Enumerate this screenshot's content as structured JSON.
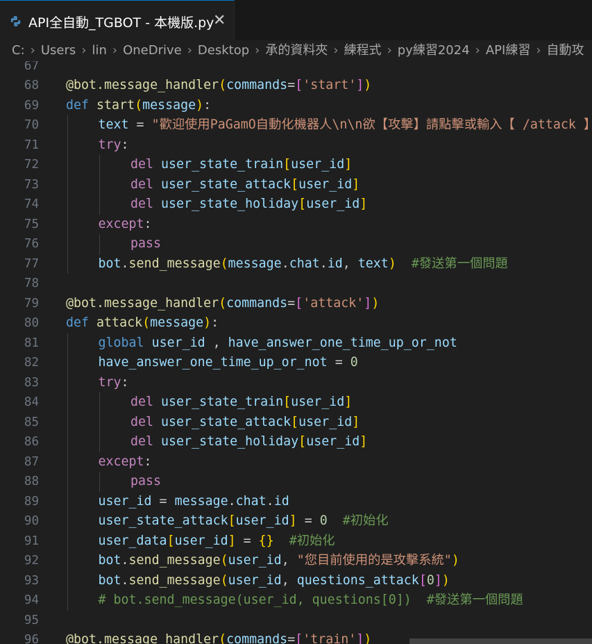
{
  "tab": {
    "title": "API全自動_TGBOT - 本機版.py",
    "close_glyph": "✕",
    "icon": "python-file-icon"
  },
  "breadcrumb": [
    "C:",
    "Users",
    "lin",
    "OneDrive",
    "Desktop",
    "承的資料夾",
    "練程式",
    "py練習2024",
    "API練習",
    "自動攻"
  ],
  "breadcrumb_separator": "›",
  "colors": {
    "editor_bg": "#1f1f1f",
    "keyword": "#569cd6",
    "control": "#c586c0",
    "function": "#dcdcaa",
    "variable": "#9cdcfe",
    "string": "#ce9178",
    "comment": "#6a9955",
    "number": "#b5cea8"
  },
  "lines": [
    {
      "n": "67",
      "indent": 0,
      "t": []
    },
    {
      "n": "68",
      "indent": 0,
      "t": [
        [
          "t-dec",
          "@bot.message_handler"
        ],
        [
          "t-b1",
          "("
        ],
        [
          "t-var",
          "commands"
        ],
        [
          "t-p",
          "="
        ],
        [
          "t-b2",
          "["
        ],
        [
          "t-str",
          "'start'"
        ],
        [
          "t-b2",
          "]"
        ],
        [
          "t-b1",
          ")"
        ]
      ]
    },
    {
      "n": "69",
      "indent": 0,
      "t": [
        [
          "t-kw",
          "def"
        ],
        [
          "t-p",
          " "
        ],
        [
          "t-fn",
          "start"
        ],
        [
          "t-b1",
          "("
        ],
        [
          "t-var",
          "message"
        ],
        [
          "t-b1",
          ")"
        ],
        [
          "t-p",
          ":"
        ]
      ]
    },
    {
      "n": "70",
      "indent": 1,
      "t": [
        [
          "t-var",
          "text"
        ],
        [
          "t-p",
          " = "
        ],
        [
          "t-str",
          "\"歡迎使用PaGamO自動化機器人\\n\\n欲【攻擊】請點擊或輸入【 /attack 】"
        ]
      ]
    },
    {
      "n": "71",
      "indent": 1,
      "t": [
        [
          "t-ctl",
          "try"
        ],
        [
          "t-p",
          ":"
        ]
      ]
    },
    {
      "n": "72",
      "indent": 2,
      "t": [
        [
          "t-ctl",
          "del"
        ],
        [
          "t-p",
          " "
        ],
        [
          "t-var",
          "user_state_train"
        ],
        [
          "t-b1",
          "["
        ],
        [
          "t-var",
          "user_id"
        ],
        [
          "t-b1",
          "]"
        ]
      ]
    },
    {
      "n": "73",
      "indent": 2,
      "t": [
        [
          "t-ctl",
          "del"
        ],
        [
          "t-p",
          " "
        ],
        [
          "t-var",
          "user_state_attack"
        ],
        [
          "t-b1",
          "["
        ],
        [
          "t-var",
          "user_id"
        ],
        [
          "t-b1",
          "]"
        ]
      ]
    },
    {
      "n": "74",
      "indent": 2,
      "t": [
        [
          "t-ctl",
          "del"
        ],
        [
          "t-p",
          " "
        ],
        [
          "t-var",
          "user_state_holiday"
        ],
        [
          "t-b1",
          "["
        ],
        [
          "t-var",
          "user_id"
        ],
        [
          "t-b1",
          "]"
        ]
      ]
    },
    {
      "n": "75",
      "indent": 1,
      "t": [
        [
          "t-ctl",
          "except"
        ],
        [
          "t-p",
          ":"
        ]
      ]
    },
    {
      "n": "76",
      "indent": 2,
      "t": [
        [
          "t-ctl",
          "pass"
        ]
      ]
    },
    {
      "n": "77",
      "indent": 1,
      "t": [
        [
          "t-var",
          "bot"
        ],
        [
          "t-p",
          "."
        ],
        [
          "t-fn",
          "send_message"
        ],
        [
          "t-b1",
          "("
        ],
        [
          "t-var",
          "message"
        ],
        [
          "t-p",
          "."
        ],
        [
          "t-var",
          "chat"
        ],
        [
          "t-p",
          "."
        ],
        [
          "t-var",
          "id"
        ],
        [
          "t-p",
          ", "
        ],
        [
          "t-var",
          "text"
        ],
        [
          "t-b1",
          ")"
        ],
        [
          "t-p",
          "  "
        ],
        [
          "t-cm",
          "#發送第一個問題"
        ]
      ]
    },
    {
      "n": "78",
      "indent": 0,
      "t": []
    },
    {
      "n": "79",
      "indent": 0,
      "t": [
        [
          "t-dec",
          "@bot.message_handler"
        ],
        [
          "t-b1",
          "("
        ],
        [
          "t-var",
          "commands"
        ],
        [
          "t-p",
          "="
        ],
        [
          "t-b2",
          "["
        ],
        [
          "t-str",
          "'attack'"
        ],
        [
          "t-b2",
          "]"
        ],
        [
          "t-b1",
          ")"
        ]
      ]
    },
    {
      "n": "80",
      "indent": 0,
      "t": [
        [
          "t-kw",
          "def"
        ],
        [
          "t-p",
          " "
        ],
        [
          "t-fn",
          "attack"
        ],
        [
          "t-b1",
          "("
        ],
        [
          "t-var",
          "message"
        ],
        [
          "t-b1",
          ")"
        ],
        [
          "t-p",
          ":"
        ]
      ]
    },
    {
      "n": "81",
      "indent": 1,
      "t": [
        [
          "t-kw",
          "global"
        ],
        [
          "t-p",
          " "
        ],
        [
          "t-var",
          "user_id"
        ],
        [
          "t-p",
          " , "
        ],
        [
          "t-var",
          "have_answer_one_time_up_or_not"
        ]
      ]
    },
    {
      "n": "82",
      "indent": 1,
      "t": [
        [
          "t-var",
          "have_answer_one_time_up_or_not"
        ],
        [
          "t-p",
          " = "
        ],
        [
          "t-num",
          "0"
        ]
      ]
    },
    {
      "n": "83",
      "indent": 1,
      "t": [
        [
          "t-ctl",
          "try"
        ],
        [
          "t-p",
          ":"
        ]
      ]
    },
    {
      "n": "84",
      "indent": 2,
      "t": [
        [
          "t-ctl",
          "del"
        ],
        [
          "t-p",
          " "
        ],
        [
          "t-var",
          "user_state_train"
        ],
        [
          "t-b1",
          "["
        ],
        [
          "t-var",
          "user_id"
        ],
        [
          "t-b1",
          "]"
        ]
      ]
    },
    {
      "n": "85",
      "indent": 2,
      "t": [
        [
          "t-ctl",
          "del"
        ],
        [
          "t-p",
          " "
        ],
        [
          "t-var",
          "user_state_attack"
        ],
        [
          "t-b1",
          "["
        ],
        [
          "t-var",
          "user_id"
        ],
        [
          "t-b1",
          "]"
        ]
      ]
    },
    {
      "n": "86",
      "indent": 2,
      "t": [
        [
          "t-ctl",
          "del"
        ],
        [
          "t-p",
          " "
        ],
        [
          "t-var",
          "user_state_holiday"
        ],
        [
          "t-b1",
          "["
        ],
        [
          "t-var",
          "user_id"
        ],
        [
          "t-b1",
          "]"
        ]
      ]
    },
    {
      "n": "87",
      "indent": 1,
      "t": [
        [
          "t-ctl",
          "except"
        ],
        [
          "t-p",
          ":"
        ]
      ]
    },
    {
      "n": "88",
      "indent": 2,
      "t": [
        [
          "t-ctl",
          "pass"
        ]
      ]
    },
    {
      "n": "89",
      "indent": 1,
      "t": [
        [
          "t-var",
          "user_id"
        ],
        [
          "t-p",
          " = "
        ],
        [
          "t-var",
          "message"
        ],
        [
          "t-p",
          "."
        ],
        [
          "t-var",
          "chat"
        ],
        [
          "t-p",
          "."
        ],
        [
          "t-var",
          "id"
        ]
      ]
    },
    {
      "n": "90",
      "indent": 1,
      "t": [
        [
          "t-var",
          "user_state_attack"
        ],
        [
          "t-b1",
          "["
        ],
        [
          "t-var",
          "user_id"
        ],
        [
          "t-b1",
          "]"
        ],
        [
          "t-p",
          " = "
        ],
        [
          "t-num",
          "0"
        ],
        [
          "t-p",
          "  "
        ],
        [
          "t-cm",
          "#初始化"
        ]
      ]
    },
    {
      "n": "91",
      "indent": 1,
      "t": [
        [
          "t-var",
          "user_data"
        ],
        [
          "t-b1",
          "["
        ],
        [
          "t-var",
          "user_id"
        ],
        [
          "t-b1",
          "]"
        ],
        [
          "t-p",
          " = "
        ],
        [
          "t-b1",
          "{}"
        ],
        [
          "t-p",
          "  "
        ],
        [
          "t-cm",
          "#初始化"
        ]
      ]
    },
    {
      "n": "92",
      "indent": 1,
      "t": [
        [
          "t-var",
          "bot"
        ],
        [
          "t-p",
          "."
        ],
        [
          "t-fn",
          "send_message"
        ],
        [
          "t-b1",
          "("
        ],
        [
          "t-var",
          "user_id"
        ],
        [
          "t-p",
          ", "
        ],
        [
          "t-str",
          "\"您目前使用的是攻擊系統\""
        ],
        [
          "t-b1",
          ")"
        ]
      ]
    },
    {
      "n": "93",
      "indent": 1,
      "t": [
        [
          "t-var",
          "bot"
        ],
        [
          "t-p",
          "."
        ],
        [
          "t-fn",
          "send_message"
        ],
        [
          "t-b1",
          "("
        ],
        [
          "t-var",
          "user_id"
        ],
        [
          "t-p",
          ", "
        ],
        [
          "t-var",
          "questions_attack"
        ],
        [
          "t-b2",
          "["
        ],
        [
          "t-num",
          "0"
        ],
        [
          "t-b2",
          "]"
        ],
        [
          "t-b1",
          ")"
        ]
      ]
    },
    {
      "n": "94",
      "indent": 1,
      "t": [
        [
          "t-cm",
          "# bot.send_message(user_id, questions[0])  #發送第一個問題"
        ]
      ]
    },
    {
      "n": "95",
      "indent": 0,
      "t": []
    },
    {
      "n": "96",
      "indent": 0,
      "t": [
        [
          "t-dec",
          "@bot.message_handler"
        ],
        [
          "t-b1",
          "("
        ],
        [
          "t-var",
          "commands"
        ],
        [
          "t-p",
          "="
        ],
        [
          "t-b2",
          "["
        ],
        [
          "t-str",
          "'train'"
        ],
        [
          "t-b2",
          "]"
        ],
        [
          "t-b1",
          ")"
        ]
      ]
    }
  ]
}
